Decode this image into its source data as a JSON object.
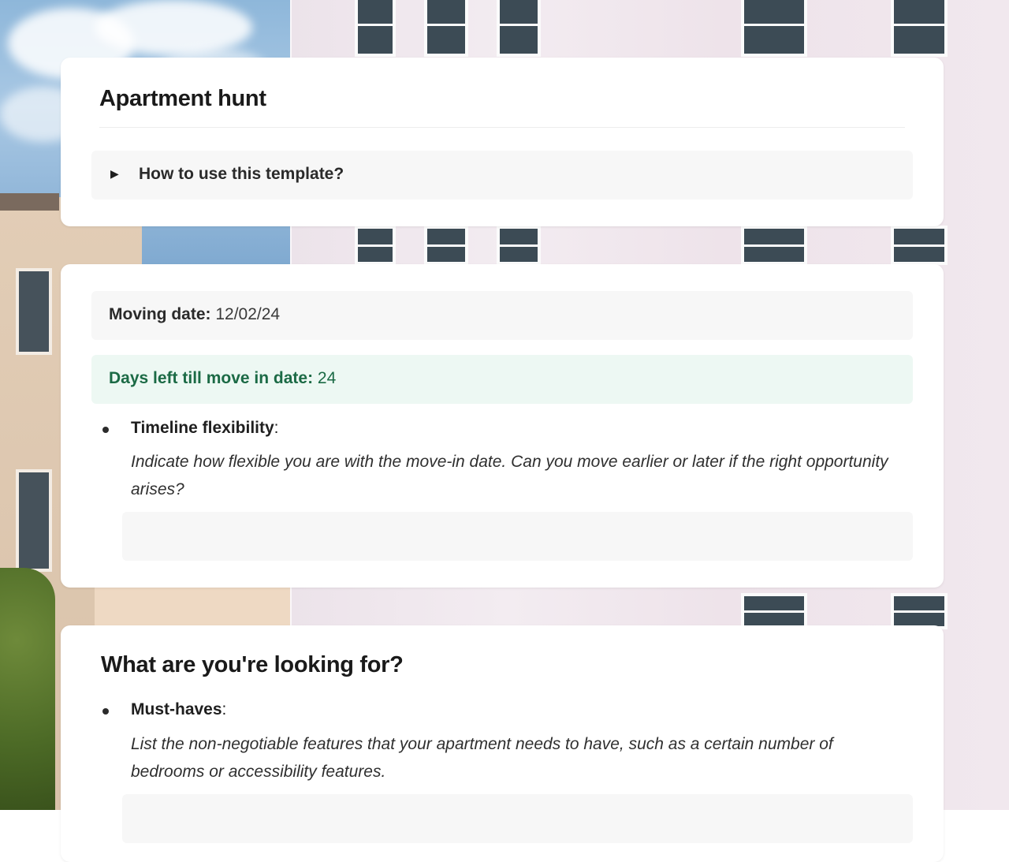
{
  "header": {
    "title": "Apartment hunt",
    "toggle_label": "How to use this template?"
  },
  "moving": {
    "date_label": "Moving date:",
    "date_value": "12/02/24",
    "days_left_label": "Days left till move in date:",
    "days_left_value": "24"
  },
  "timeline": {
    "title": "Timeline flexibility",
    "suffix": ":",
    "description": "Indicate how flexible you are with the move-in date. Can you move earlier or later if the right opportunity arises?",
    "value": ""
  },
  "looking_for": {
    "title": "What are you're looking for?",
    "must_haves": {
      "title": "Must-haves",
      "suffix": ":",
      "description": "List the non-negotiable features that your apartment needs to have, such as a certain number of bedrooms or accessibility features."
    }
  },
  "icons": {
    "toggle": "triangle-right-icon",
    "bullet": "bullet-dot-icon"
  },
  "colors": {
    "card_bg": "#ffffff",
    "field_bg": "#f7f7f7",
    "days_bg": "#edf8f3",
    "days_text": "#1b6a45"
  }
}
